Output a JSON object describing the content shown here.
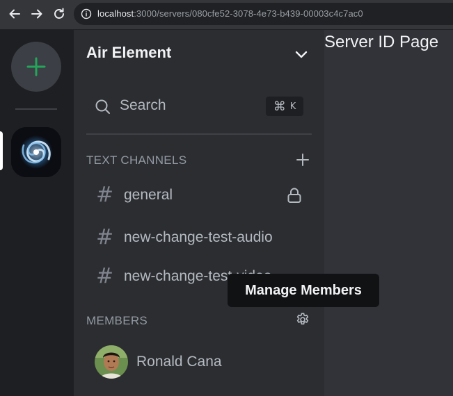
{
  "browser": {
    "url_host": "localhost",
    "url_path": ":3000/servers/080cfe52-3078-4e73-b439-00003c4c7ac0"
  },
  "server_rail": {
    "add_server_icon": "plus-icon",
    "servers": [
      {
        "icon": "spiral-galaxy"
      }
    ]
  },
  "sidebar": {
    "server_name": "Air Element",
    "search_label": "Search",
    "search_shortcut_symbol": "⌘",
    "search_shortcut_key": "K",
    "text_channels_label": "TEXT CHANNELS",
    "channels": [
      {
        "name": "general",
        "locked": true
      },
      {
        "name": "new-change-test-audio"
      },
      {
        "name": "new-change-test-video"
      }
    ],
    "members_label": "MEMBERS",
    "members": [
      {
        "name": "Ronald Cana"
      }
    ]
  },
  "main": {
    "title": "Server ID Page"
  },
  "tooltip": {
    "text": "Manage Members"
  },
  "colors": {
    "accent_green": "#23a55a",
    "sidebar_bg": "#2b2d31",
    "rail_bg": "#1e1f22",
    "main_bg": "#313338"
  }
}
